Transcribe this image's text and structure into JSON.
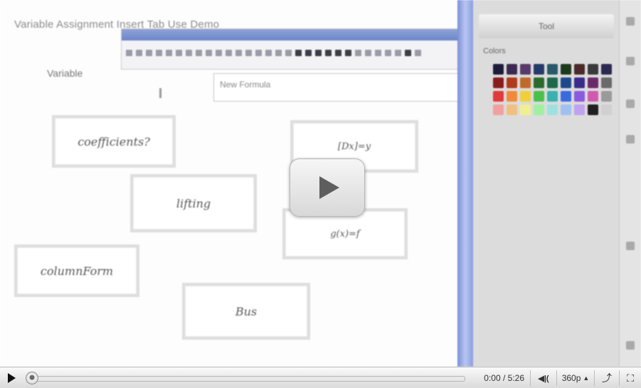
{
  "video": {
    "document_title": "Variable Assignment Insert Tab Use Demo",
    "variable_label": "Variable",
    "formula_input_placeholder": "New Formula",
    "nodes": [
      {
        "label": "coefficients?"
      },
      {
        "label": "[Dx]=y"
      },
      {
        "label": "lifting"
      },
      {
        "label": "g(x)=f"
      },
      {
        "label": "columnForm"
      },
      {
        "label": "Bus"
      }
    ],
    "side_panel": {
      "tab_label": "Tool",
      "section_label": "Colors"
    },
    "palette": [
      "#1c1c3a",
      "#3a2a52",
      "#5a3a6a",
      "#243a6a",
      "#2a5a6a",
      "#1c3a1c",
      "#4a2a2a",
      "#3a3a3a",
      "#2a2a52",
      "#8a1c1c",
      "#b03a1c",
      "#c06a2a",
      "#2a6a2a",
      "#1c6a4a",
      "#1c4a8a",
      "#3a2a8a",
      "#6a2a6a",
      "#6a6a6a",
      "#e03a3a",
      "#f08a3a",
      "#f0d03a",
      "#4ac04a",
      "#3ab0b0",
      "#3a6ae0",
      "#8a5ae0",
      "#d05ab0",
      "#9a9a9a",
      "#f0a0a0",
      "#f0c080",
      "#f0f090",
      "#a0f0a0",
      "#a0e0e0",
      "#a0c0f0",
      "#c0a0f0",
      "#202020",
      "#d0d0d0"
    ],
    "play_overlay_icon": "play-icon"
  },
  "controls": {
    "time_display": "0:00 / 5:26",
    "volume_label": "◀︎|(",
    "quality_label": "360p",
    "quality_arrow": "▲",
    "popout_icon": "popout-icon",
    "popout_glyph": "⤴",
    "fullscreen_icon": "fullscreen-icon",
    "fullscreen_glyph": "⛶",
    "progress_fraction": 0.0
  }
}
